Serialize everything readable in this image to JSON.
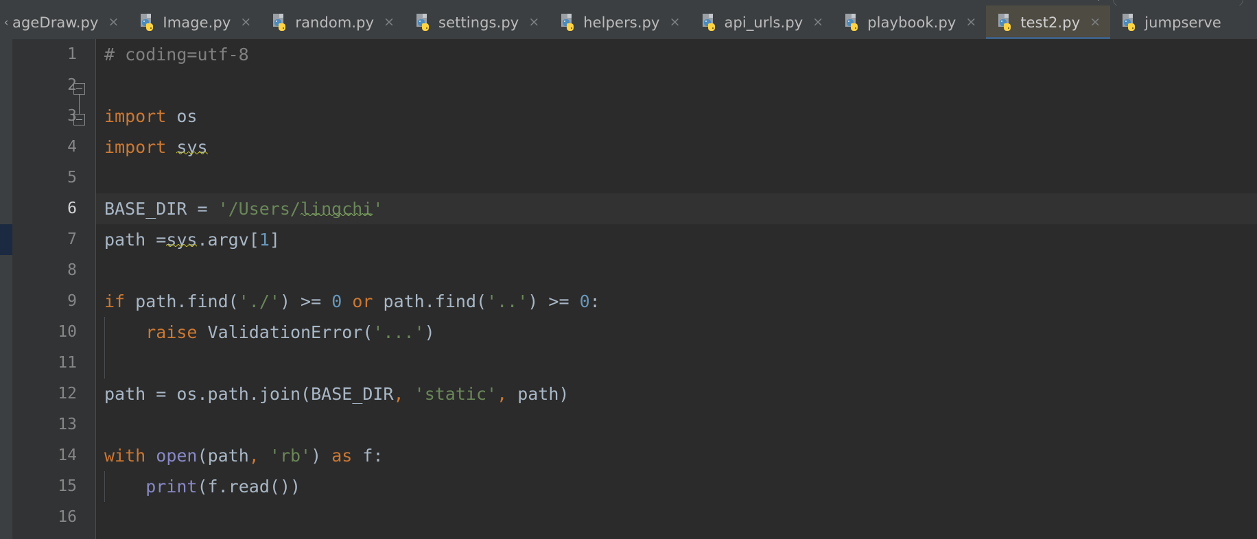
{
  "window": {
    "theme": "darcula",
    "accent_active_tab_underline": "#3d6185",
    "editor_background": "#2b2b2b",
    "gutter_background": "#313335",
    "tabbar_background": "#3c3f41",
    "active_tab_background": "#4e4b42"
  },
  "toolbar": {
    "plus_label": "+",
    "search_pill_label": ""
  },
  "tabbar": {
    "scroll_left_icon": "chevron-left-icon",
    "tabs": [
      {
        "label": "ageDraw.py",
        "full_label": "ImageDraw.py",
        "icon": "python-file-icon",
        "close_label": "×",
        "active": false,
        "clipped": true
      },
      {
        "label": "Image.py",
        "full_label": "Image.py",
        "icon": "python-file-icon",
        "close_label": "×",
        "active": false,
        "clipped": false
      },
      {
        "label": "random.py",
        "full_label": "random.py",
        "icon": "python-file-icon",
        "close_label": "×",
        "active": false,
        "clipped": false
      },
      {
        "label": "settings.py",
        "full_label": "settings.py",
        "icon": "python-file-icon",
        "close_label": "×",
        "active": false,
        "clipped": false
      },
      {
        "label": "helpers.py",
        "full_label": "helpers.py",
        "icon": "python-file-icon",
        "close_label": "×",
        "active": false,
        "clipped": false
      },
      {
        "label": "api_urls.py",
        "full_label": "api_urls.py",
        "icon": "python-file-icon",
        "close_label": "×",
        "active": false,
        "clipped": false
      },
      {
        "label": "playbook.py",
        "full_label": "playbook.py",
        "icon": "python-file-icon",
        "close_label": "×",
        "active": false,
        "clipped": false
      },
      {
        "label": "test2.py",
        "full_label": "test2.py",
        "icon": "python-file-icon",
        "close_label": "×",
        "active": true,
        "clipped": false
      },
      {
        "label": "jumpserve",
        "full_label": "jumpserver",
        "icon": "python-file-icon",
        "close_label": "",
        "active": false,
        "clipped": true
      }
    ]
  },
  "editor": {
    "active_file": "test2.py",
    "language": "Python",
    "current_line": 6,
    "line_numbers": [
      "1",
      "2",
      "3",
      "4",
      "5",
      "6",
      "7",
      "8",
      "9",
      "10",
      "11",
      "12",
      "13",
      "14",
      "15",
      "16"
    ],
    "fold_markers": [
      {
        "line": 3,
        "type": "fold-collapse-start"
      },
      {
        "line": 4,
        "type": "fold-collapse-end"
      }
    ],
    "change_markers": [
      {
        "line": 7,
        "color": "#1b2a40",
        "kind": "vcs-modified-marker"
      }
    ],
    "lines": [
      {
        "n": 1,
        "text": "# coding=utf-8"
      },
      {
        "n": 2,
        "text": ""
      },
      {
        "n": 3,
        "text": "import os"
      },
      {
        "n": 4,
        "text": "import sys"
      },
      {
        "n": 5,
        "text": ""
      },
      {
        "n": 6,
        "text": "BASE_DIR = '/Users/lingchi'"
      },
      {
        "n": 7,
        "text": "path =sys.argv[1]"
      },
      {
        "n": 8,
        "text": ""
      },
      {
        "n": 9,
        "text": "if path.find('./') >= 0 or path.find('..') >= 0:"
      },
      {
        "n": 10,
        "text": "    raise ValidationError('...')"
      },
      {
        "n": 11,
        "text": ""
      },
      {
        "n": 12,
        "text": "path = os.path.join(BASE_DIR, 'static', path)"
      },
      {
        "n": 13,
        "text": ""
      },
      {
        "n": 14,
        "text": "with open(path, 'rb') as f:"
      },
      {
        "n": 15,
        "text": "    print(f.read())"
      },
      {
        "n": 16,
        "text": ""
      }
    ],
    "inspections": [
      {
        "line": 4,
        "target": "sys",
        "severity": "weak-warning",
        "color": "#bbb529"
      },
      {
        "line": 6,
        "target": "lingchi",
        "severity": "typo",
        "color": "#7aa05a"
      },
      {
        "line": 7,
        "target": "sys",
        "severity": "weak-warning",
        "color": "#bbb529"
      }
    ],
    "colors": {
      "keyword": "#cc7832",
      "string": "#6a8759",
      "number": "#6897bb",
      "builtin": "#8888c6",
      "comment": "#808080",
      "plain": "#a9b7c6",
      "current_line_bg": "#323232"
    }
  }
}
